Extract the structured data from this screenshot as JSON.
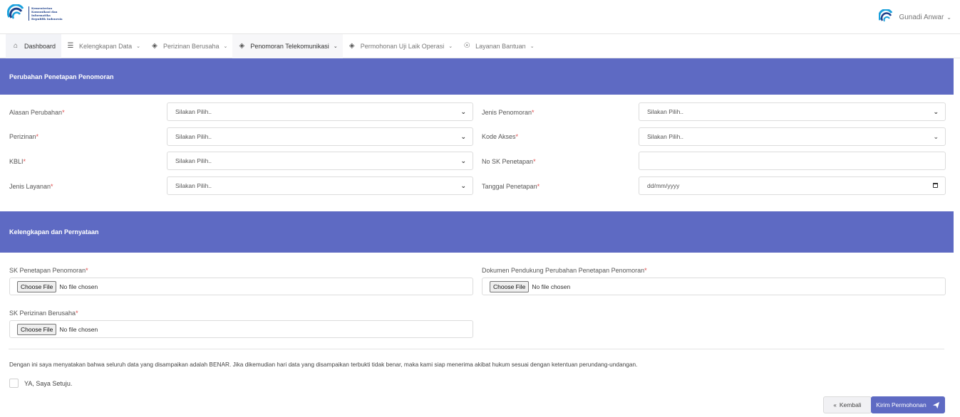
{
  "header": {
    "logo_lines": [
      "Kementerian",
      "Komunikasi dan",
      "Informatika",
      "Republik Indonesia"
    ],
    "user_name": "Gunadi Anwar"
  },
  "nav": {
    "items": [
      {
        "label": "Dashboard",
        "icon": "home-icon"
      },
      {
        "label": "Kelengkapan Data",
        "icon": "list-icon"
      },
      {
        "label": "Perizinan Berusaha",
        "icon": "layers-icon"
      },
      {
        "label": "Penomoran Telekomunikasi",
        "icon": "layers-icon"
      },
      {
        "label": "Permohonan Uji Laik Operasi",
        "icon": "layers-icon"
      },
      {
        "label": "Layanan Bantuan",
        "icon": "support-icon"
      }
    ]
  },
  "section1": {
    "title": "Perubahan Penetapan Penomoran",
    "fields": {
      "alasan": {
        "label": "Alasan Perubahan",
        "value": "Silakan Pilih.."
      },
      "perizinan": {
        "label": "Perizinan",
        "value": "Silakan Pilih.."
      },
      "kbli": {
        "label": "KBLI",
        "value": "Silakan Pilih.."
      },
      "jenis_layanan": {
        "label": "Jenis Layanan",
        "value": "Silakan Pilih.."
      },
      "jenis_penomoran": {
        "label": "Jenis Penomoran",
        "value": "Silakan Pilih.."
      },
      "kode_akses": {
        "label": "Kode Akses",
        "value": "Silakan Pilih.."
      },
      "no_sk": {
        "label": "No SK Penetapan",
        "value": ""
      },
      "tanggal": {
        "label": "Tanggal Penetapan",
        "value": "dd/mm/yyyy"
      }
    },
    "required_mark": "*"
  },
  "section2": {
    "title": "Kelengkapan dan Pernyataan",
    "files": {
      "sk_penetapan": {
        "label": "SK Penetapan Penomoran"
      },
      "dokumen": {
        "label": "Dokumen Pendukung Perubahan Penetapan Penomoran"
      },
      "sk_perizinan": {
        "label": "SK Perizinan Berusaha"
      }
    },
    "choose_file": "Choose File",
    "no_file": "No file chosen",
    "statement": "Dengan ini saya menyatakan bahwa seluruh data yang disampaikan adalah BENAR. Jika dikemudian hari data yang disampaikan terbukti tidak benar, maka kami siap menerima akibat hukum sesuai dengan ketentuan perundang-undangan.",
    "agree_label": "YA, Saya Setuju."
  },
  "actions": {
    "back_label": "Kembali",
    "submit_label": "Kirim Permohonan"
  },
  "colors": {
    "accent": "#5e6ac3",
    "required": "#e04a4a"
  }
}
